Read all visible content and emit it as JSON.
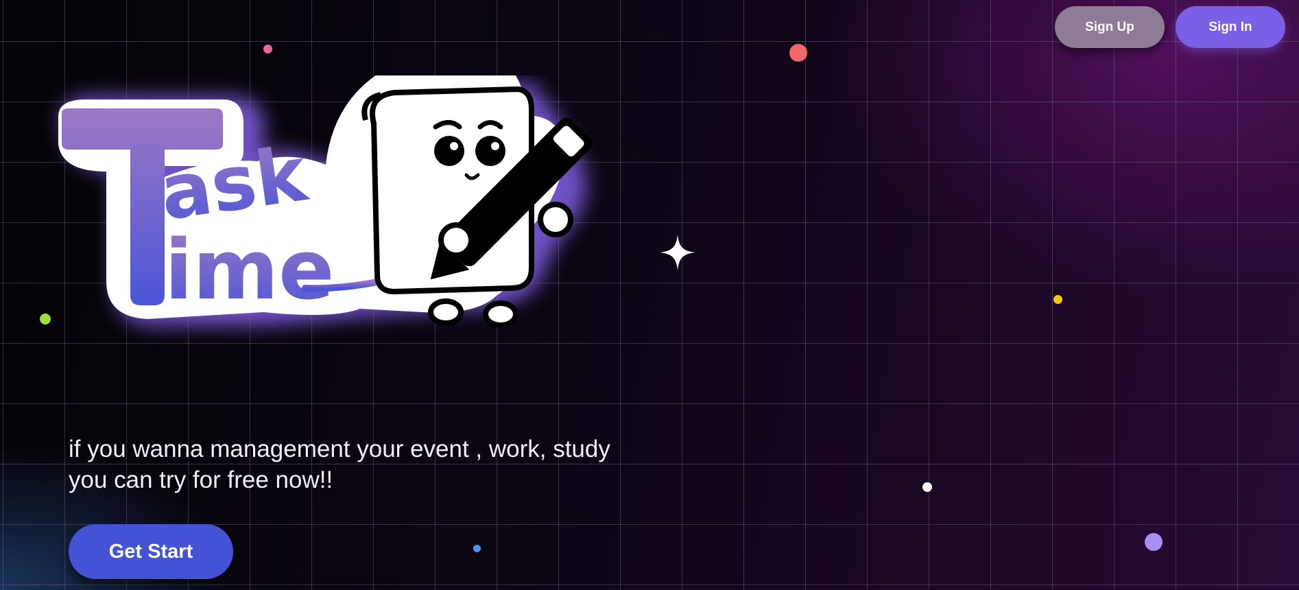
{
  "header": {
    "signup_label": "Sign Up",
    "signin_label": "Sign In"
  },
  "hero": {
    "logo_text_1": "Task",
    "logo_text_2": "Time",
    "logo_mascot": "paper-with-pencil-mascot",
    "tagline": "if you wanna management your event , work, study you can try for free now!!",
    "cta_label": "Get Start"
  },
  "decor": {
    "sparkle_icon": "four-point-star-icon",
    "dot_colors": [
      "#e9679b",
      "#f26a6a",
      "#9be23a",
      "#f5c518",
      "#ffffff",
      "#4f8ff0",
      "#a98cf5"
    ]
  },
  "colors": {
    "accent": "#7b5fe6",
    "cta": "#4452d6",
    "signup": "#8e7b96",
    "logo_gradient_top": "#9b78c4",
    "logo_gradient_bottom": "#4b55d8"
  }
}
